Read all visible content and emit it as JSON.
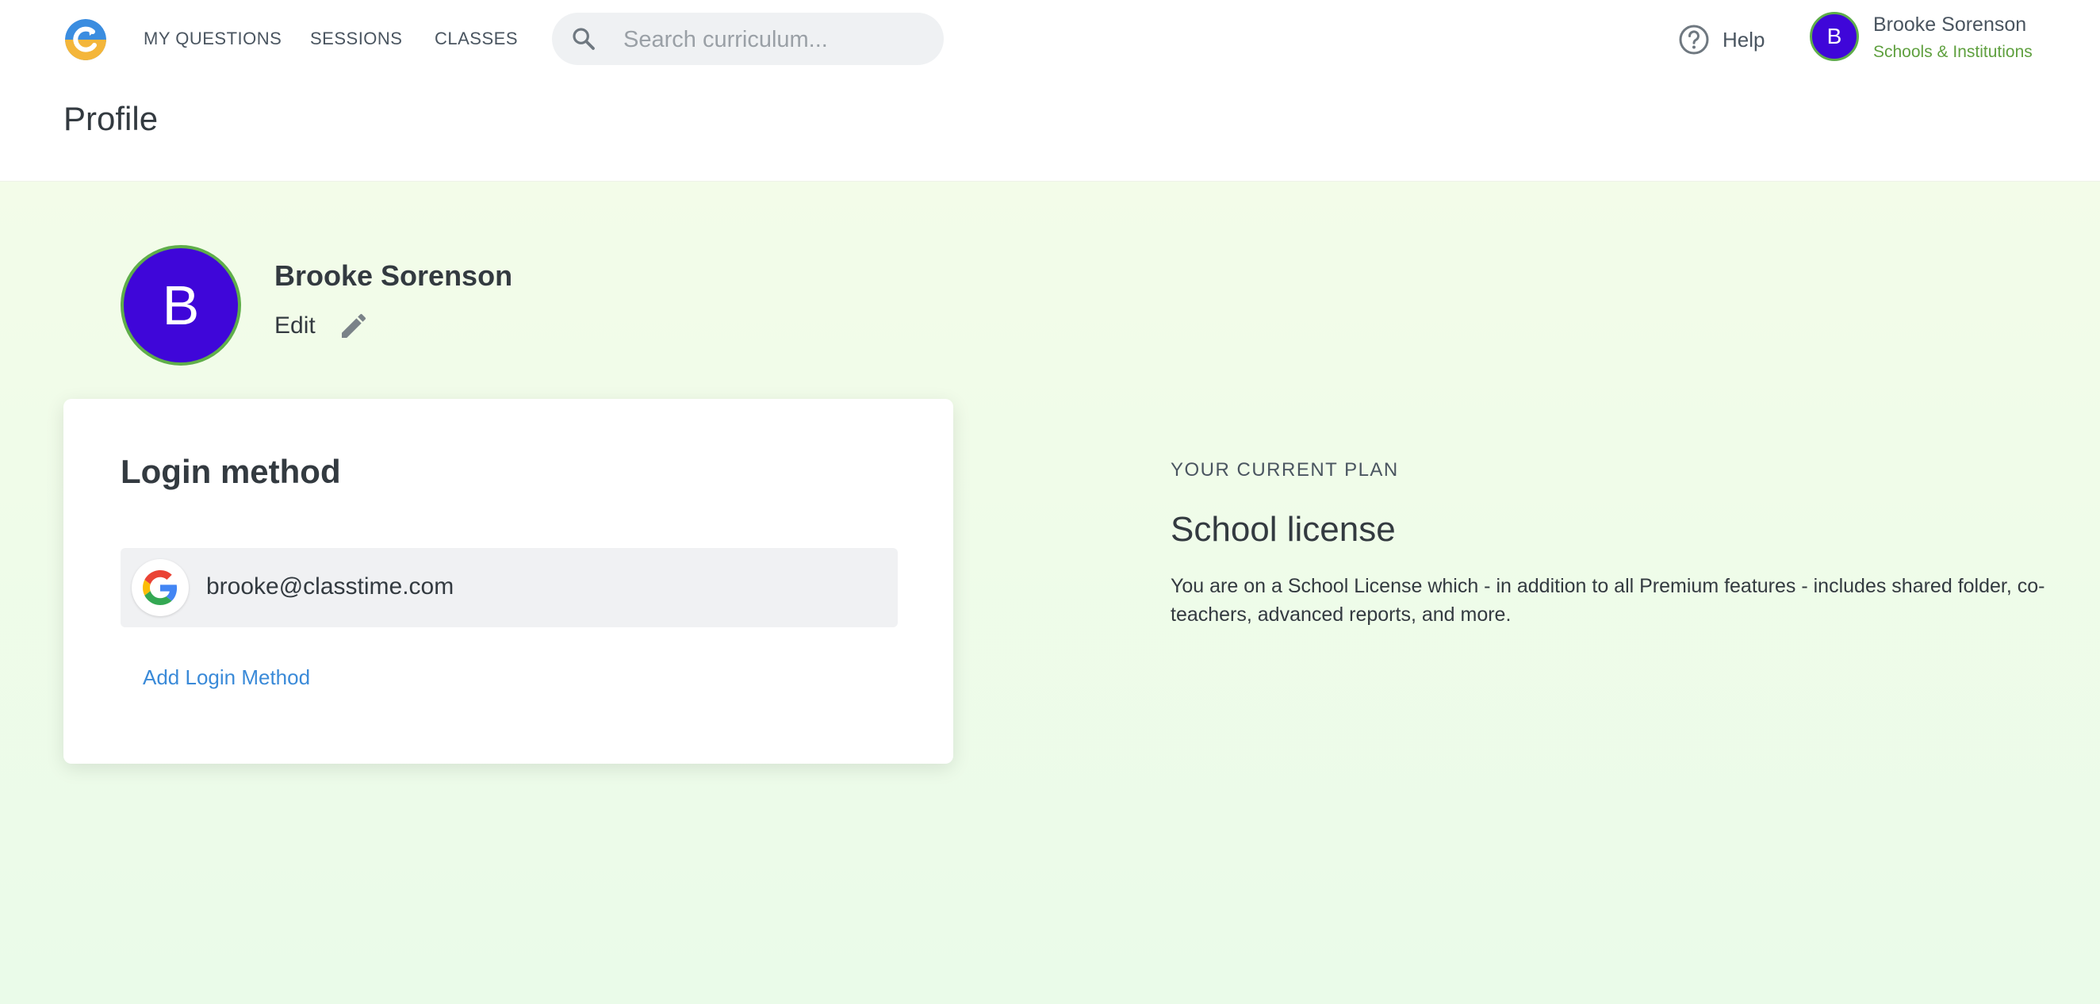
{
  "nav": {
    "links": [
      "MY QUESTIONS",
      "SESSIONS",
      "CLASSES"
    ],
    "search_placeholder": "Search curriculum...",
    "help_label": "Help",
    "account": {
      "initial": "B",
      "name": "Brooke Sorenson",
      "org": "Schools & Institutions"
    }
  },
  "header": {
    "title": "Profile"
  },
  "profile": {
    "initial": "B",
    "name": "Brooke Sorenson",
    "edit_label": "Edit"
  },
  "login_card": {
    "title": "Login method",
    "methods": [
      {
        "provider_icon": "google-icon",
        "email": "brooke@classtime.com"
      }
    ],
    "add_label": "Add Login Method"
  },
  "plan": {
    "kicker": "YOUR CURRENT PLAN",
    "name": "School license",
    "description": "You are on a School License which - in addition to all Premium features - includes shared folder, co-teachers, advanced reports, and more."
  },
  "colors": {
    "avatar_bg": "#3f06d9",
    "avatar_ring": "#5fae4a",
    "link": "#3a8ad8",
    "org_green": "#5fa03f",
    "bg_gradient_top": "#f3fce9"
  }
}
